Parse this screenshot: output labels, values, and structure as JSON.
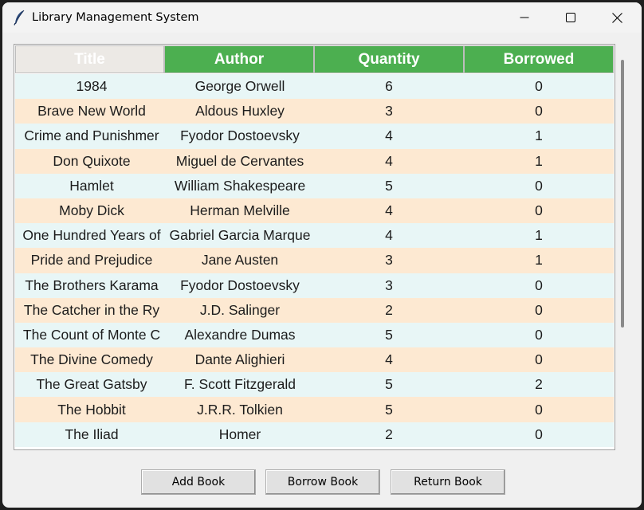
{
  "window": {
    "title": "Library Management System",
    "app_icon": "feather-icon",
    "controls": [
      "minimize-icon",
      "maximize-icon",
      "close-icon"
    ]
  },
  "table": {
    "columns": [
      "Title",
      "Author",
      "Quantity",
      "Borrowed"
    ],
    "header_color": "#4caf50",
    "row_colors": [
      "#e8f6f6",
      "#fde9d2"
    ],
    "rows": [
      [
        "1984",
        "George Orwell",
        "6",
        "0"
      ],
      [
        "Brave New World",
        "Aldous Huxley",
        "3",
        "0"
      ],
      [
        "Crime and Punishmer",
        "Fyodor Dostoevsky",
        "4",
        "1"
      ],
      [
        "Don Quixote",
        "Miguel de Cervantes",
        "4",
        "1"
      ],
      [
        "Hamlet",
        "William Shakespeare",
        "5",
        "0"
      ],
      [
        "Moby Dick",
        "Herman Melville",
        "4",
        "0"
      ],
      [
        "One Hundred Years of",
        "Gabriel Garcia Marque",
        "4",
        "1"
      ],
      [
        "Pride and Prejudice",
        "Jane Austen",
        "3",
        "1"
      ],
      [
        "The Brothers Karama",
        "Fyodor Dostoevsky",
        "3",
        "0"
      ],
      [
        "The Catcher in the Ry",
        "J.D. Salinger",
        "2",
        "0"
      ],
      [
        "The Count of Monte C",
        "Alexandre Dumas",
        "5",
        "0"
      ],
      [
        "The Divine Comedy",
        "Dante Alighieri",
        "4",
        "0"
      ],
      [
        "The Great Gatsby",
        "F. Scott Fitzgerald",
        "5",
        "2"
      ],
      [
        "The Hobbit",
        "J.R.R. Tolkien",
        "5",
        "0"
      ],
      [
        "The Iliad",
        "Homer",
        "2",
        "0"
      ]
    ]
  },
  "buttons": {
    "add": "Add Book",
    "borrow": "Borrow Book",
    "return": "Return Book"
  }
}
